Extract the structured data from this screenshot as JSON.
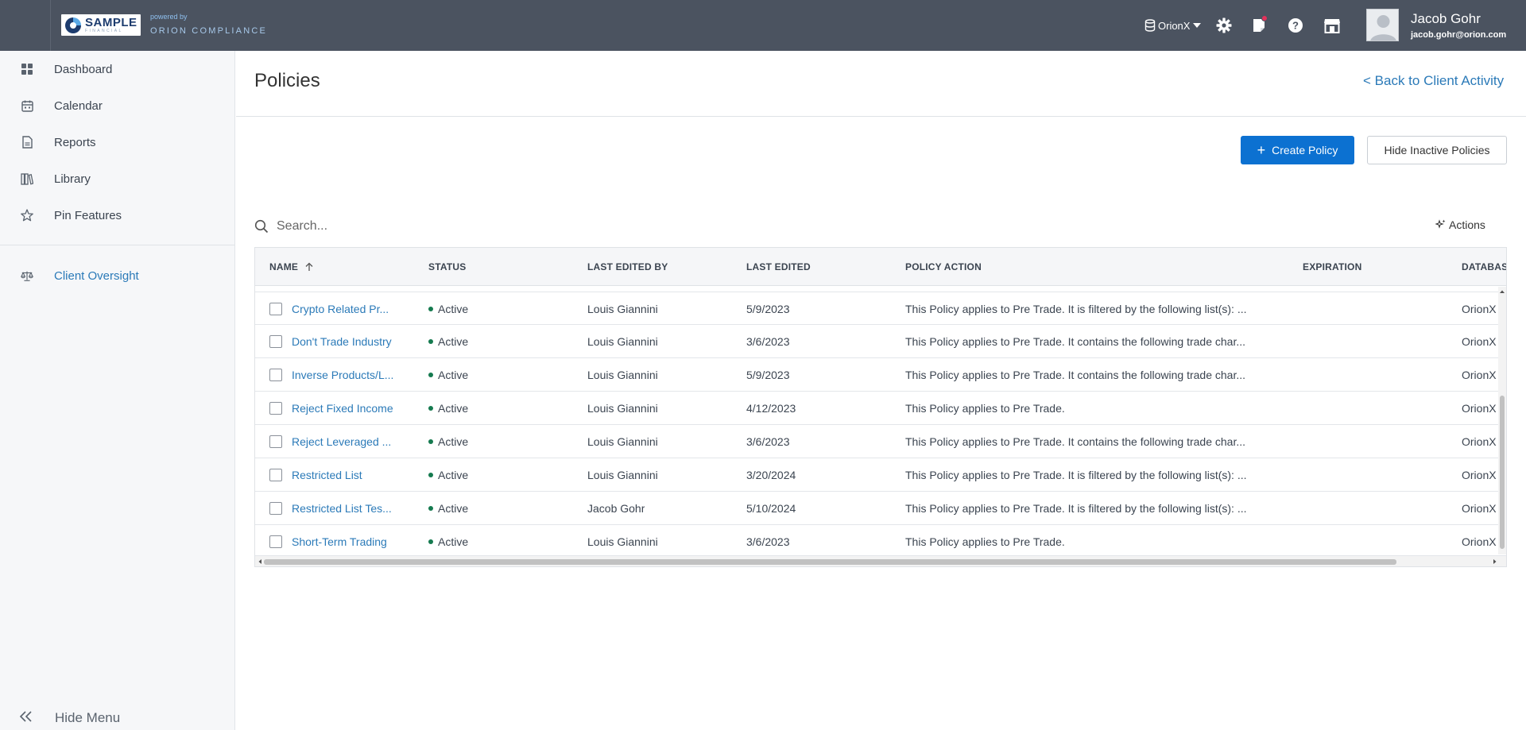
{
  "brand": {
    "logo_name": "SAMPLE",
    "logo_sub": "FINANCIAL",
    "powered_by": "powered by",
    "product": "ORION COMPLIANCE"
  },
  "topbar": {
    "database": "OrionX",
    "user_name": "Jacob Gohr",
    "user_email": "jacob.gohr@orion.com",
    "icons": [
      "database-icon",
      "gear-icon",
      "notifications-icon",
      "help-icon",
      "store-icon"
    ],
    "notification_color": "#e2315a"
  },
  "sidebar": {
    "items": [
      {
        "label": "Dashboard",
        "icon": "dashboard-icon"
      },
      {
        "label": "Calendar",
        "icon": "calendar-icon"
      },
      {
        "label": "Reports",
        "icon": "reports-icon"
      },
      {
        "label": "Library",
        "icon": "library-icon"
      },
      {
        "label": "Pin Features",
        "icon": "star-icon"
      }
    ],
    "active_item": {
      "label": "Client Oversight",
      "icon": "scale-icon"
    },
    "hide_menu": "Hide Menu"
  },
  "page": {
    "title": "Policies",
    "back_link": "< Back to Client Activity",
    "create_button": "Create Policy",
    "hide_inactive_button": "Hide Inactive Policies",
    "search_placeholder": "Search...",
    "actions_label": "Actions"
  },
  "table": {
    "columns": [
      "NAME",
      "STATUS",
      "LAST EDITED BY",
      "LAST EDITED",
      "POLICY ACTION",
      "EXPIRATION",
      "DATABAS"
    ],
    "sort_column": "NAME",
    "sort_direction": "ascending",
    "rows": [
      {
        "name": "Crypto Related Pr...",
        "status": "Active",
        "edited_by": "Louis Giannini",
        "edited": "5/9/2023",
        "action": "This Policy applies to Pre Trade. It is filtered by the following list(s): ...",
        "expiration": "",
        "database": "OrionX"
      },
      {
        "name": "Don't Trade Industry",
        "status": "Active",
        "edited_by": "Louis Giannini",
        "edited": "3/6/2023",
        "action": "This Policy applies to Pre Trade. It contains the following trade char...",
        "expiration": "",
        "database": "OrionX"
      },
      {
        "name": "Inverse Products/L...",
        "status": "Active",
        "edited_by": "Louis Giannini",
        "edited": "5/9/2023",
        "action": "This Policy applies to Pre Trade. It contains the following trade char...",
        "expiration": "",
        "database": "OrionX"
      },
      {
        "name": "Reject Fixed Income",
        "status": "Active",
        "edited_by": "Louis Giannini",
        "edited": "4/12/2023",
        "action": "This Policy applies to Pre Trade.",
        "expiration": "",
        "database": "OrionX"
      },
      {
        "name": "Reject Leveraged ...",
        "status": "Active",
        "edited_by": "Louis Giannini",
        "edited": "3/6/2023",
        "action": "This Policy applies to Pre Trade. It contains the following trade char...",
        "expiration": "",
        "database": "OrionX"
      },
      {
        "name": "Restricted List",
        "status": "Active",
        "edited_by": "Louis Giannini",
        "edited": "3/20/2024",
        "action": "This Policy applies to Pre Trade. It is filtered by the following list(s): ...",
        "expiration": "",
        "database": "OrionX"
      },
      {
        "name": "Restricted List Tes...",
        "status": "Active",
        "edited_by": "Jacob Gohr",
        "edited": "5/10/2024",
        "action": "This Policy applies to Pre Trade. It is filtered by the following list(s): ...",
        "expiration": "",
        "database": "OrionX"
      },
      {
        "name": "Short-Term Trading",
        "status": "Active",
        "edited_by": "Louis Giannini",
        "edited": "3/6/2023",
        "action": "This Policy applies to Pre Trade.",
        "expiration": "",
        "database": "OrionX"
      }
    ],
    "status_color": "#157a4f"
  },
  "colors": {
    "topbar": "#4b5360",
    "accent": "#0c71d1",
    "link": "#2b7ab8",
    "sidebar_bg": "#f6f7f9"
  }
}
